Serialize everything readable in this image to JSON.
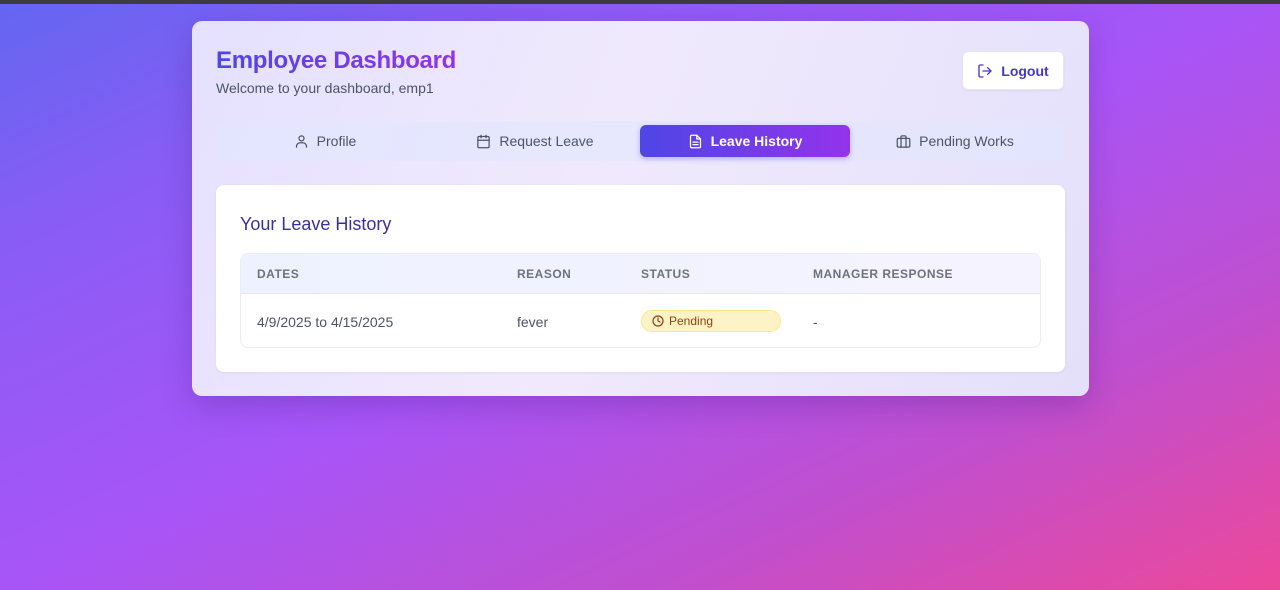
{
  "header": {
    "title": "Employee Dashboard",
    "subtitle": "Welcome to your dashboard, emp1",
    "logout_label": "Logout"
  },
  "tabs": [
    {
      "label": "Profile",
      "icon": "user-icon",
      "active": false
    },
    {
      "label": "Request Leave",
      "icon": "calendar-icon",
      "active": false
    },
    {
      "label": "Leave History",
      "icon": "document-icon",
      "active": true
    },
    {
      "label": "Pending Works",
      "icon": "briefcase-icon",
      "active": false
    }
  ],
  "history": {
    "title": "Your Leave History",
    "columns": [
      "DATES",
      "REASON",
      "STATUS",
      "MANAGER RESPONSE"
    ],
    "rows": [
      {
        "dates": "4/9/2025 to 4/15/2025",
        "reason": "fever",
        "status": "Pending",
        "manager_response": "-"
      }
    ]
  },
  "colors": {
    "accent_start": "#4f46e5",
    "accent_end": "#9333ea",
    "pending_bg": "#fef3c7",
    "pending_text": "#92400e"
  }
}
